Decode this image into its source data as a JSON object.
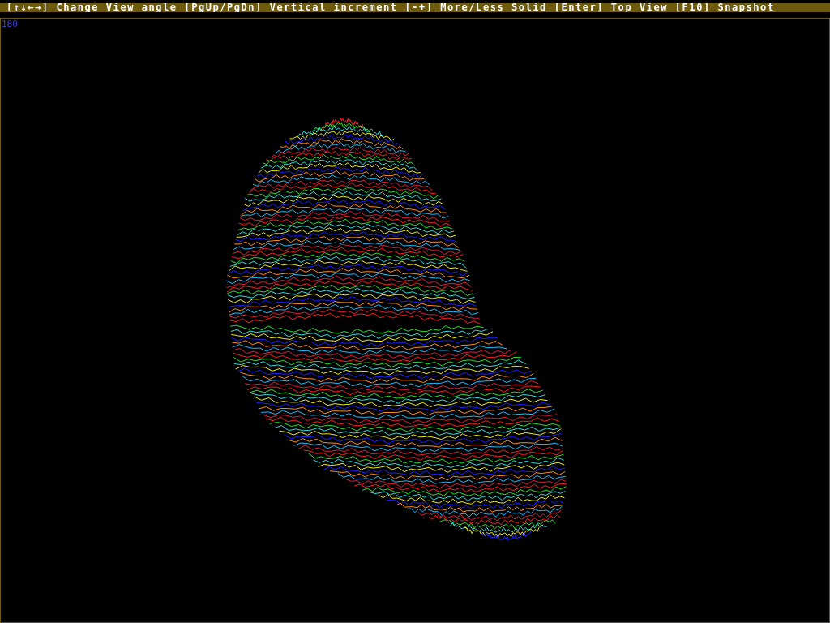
{
  "status_bar": {
    "text": "[↑↓←→] Change View angle [PgUp/PgDn] Vertical increment [-+] More/Less Solid [Enter] Top View [F10] Snapshot"
  },
  "viewer": {
    "angle_readout": "180"
  }
}
